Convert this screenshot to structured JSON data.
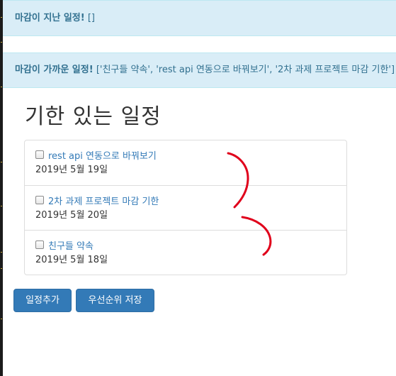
{
  "alerts": {
    "overdue": {
      "label": "마감이 지난 일정!",
      "value": "[]"
    },
    "upcoming": {
      "label": "마감이 가까운 일정!",
      "value": "['친구들 약속', 'rest api 연동으로 바꿔보기', '2차 과제 프로젝트 마감 기한']"
    }
  },
  "page_title": "기한 있는 일정",
  "tasks": [
    {
      "title": "rest api 연동으로 바꿔보기",
      "date": "2019년 5월 19일",
      "checked": false
    },
    {
      "title": "2차 과제 프로젝트 마감 기한",
      "date": "2019년 5월 20일",
      "checked": false
    },
    {
      "title": "친구들 약속",
      "date": "2019년 5월 18일",
      "checked": false
    }
  ],
  "buttons": {
    "add": "일정추가",
    "save_priority": "우선순위 저장"
  },
  "colors": {
    "alert_bg": "#d9edf7",
    "alert_text": "#31708f",
    "link": "#337ab7",
    "button": "#337ab7",
    "annotation": "#e0001b"
  }
}
